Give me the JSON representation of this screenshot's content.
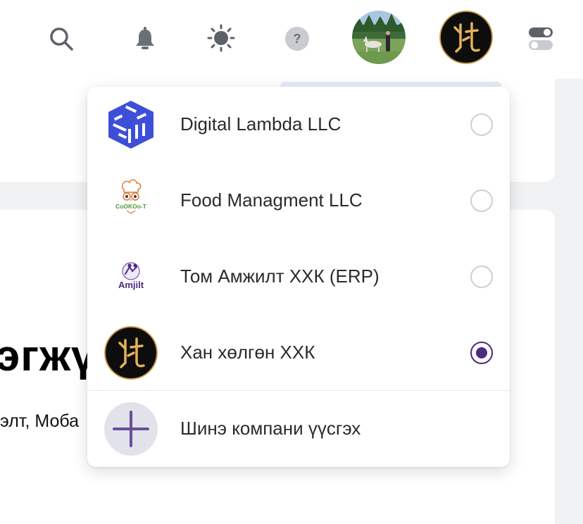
{
  "header": {
    "icons": [
      "search-icon",
      "bell-icon",
      "sun-icon",
      "help-icon",
      "toggle-icon"
    ],
    "help_glyph": "?",
    "user_avatar": "user-avatar",
    "company_avatar": "company-avatar"
  },
  "background": {
    "heading_fragment": "эгжү",
    "sub_fragment": "элт, Моба"
  },
  "company_switcher": {
    "companies": [
      {
        "name": "Digital Lambda LLC",
        "logo": "digital-lambda-logo",
        "selected": false
      },
      {
        "name": "Food Managment LLC",
        "logo": "cookoo-logo",
        "logo_text": "CoOKOo-T",
        "selected": false
      },
      {
        "name": "Том Амжилт ХХК (ERP)",
        "logo": "amjilt-logo",
        "logo_text": "Amjilt",
        "selected": false
      },
      {
        "name": "Хан хөлгөн ХХК",
        "logo": "khan-khulgun-logo",
        "selected": true
      }
    ],
    "create_label": "Шинэ компани үүсгэх"
  },
  "colors": {
    "accent": "#4b2a84",
    "plus": "#6a4f9e",
    "lambda_blue": "#3d4fd9",
    "gold": "#d9a84a"
  }
}
